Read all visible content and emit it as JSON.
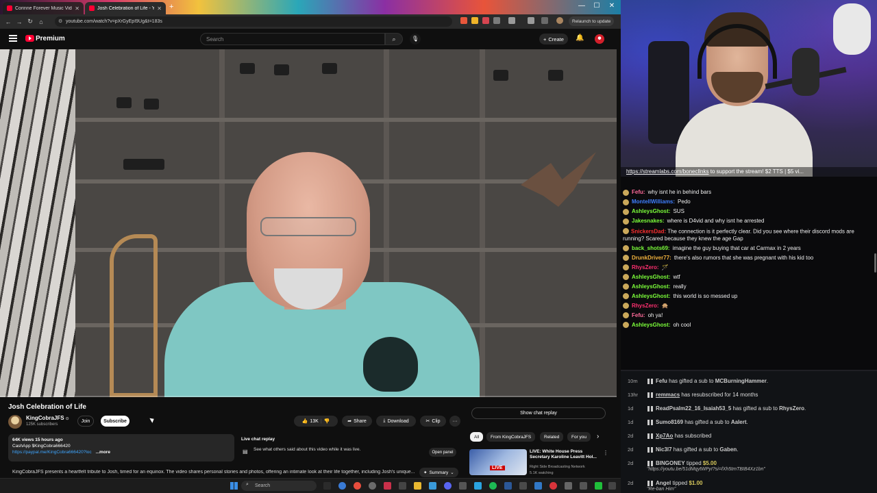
{
  "browser": {
    "tabs": [
      {
        "label": "Corinne Forever Music Video - ",
        "active": false
      },
      {
        "label": "Josh Celebration of Life - Y",
        "active": true
      }
    ],
    "new_tab": "+",
    "url": "youtube.com/watch?v=pXrGyEpI9Ug&t=183s",
    "relaunch": "Relaunch to update",
    "window_controls": [
      "—",
      "☐",
      "✕"
    ],
    "nav": [
      "←",
      "→",
      "↻",
      "⌂"
    ]
  },
  "youtube": {
    "brand": "Premium",
    "search_placeholder": "Search",
    "create": "Create",
    "create_icon": "+"
  },
  "video": {
    "title": "Josh Celebration of Life",
    "progress": 0.0
  },
  "channel": {
    "name": "KingCobraJFS",
    "verified": "⊙",
    "subscribers": "125K subscribers",
    "join": "Join",
    "subscribe": "Subscribe"
  },
  "actions": {
    "likes": "13K",
    "share": "Share",
    "download": "Download",
    "clip": "Clip",
    "more": "···"
  },
  "description": {
    "views_time": "64K views  15 hours ago",
    "cashapp": "CashApp $KingCobra666420",
    "paypal": "https://paypal.me/KingCobra666420?loc",
    "more": "...more",
    "summary_line": "KingCobraJFS presents a heartfelt tribute to Josh, timed for an equinox. The video shares personal stories and photos, offering an intimate look at their life together, including Josh's unique...",
    "summary_label": "Summary"
  },
  "live_chat_replay": {
    "heading": "Live chat replay",
    "text": "See what others said about this video while it was live.",
    "open_panel": "Open panel"
  },
  "sidebar": {
    "show_chat": "Show chat replay",
    "chips": [
      "All",
      "From KingCobraJFS",
      "Related",
      "For you"
    ],
    "chip_next": "›",
    "recommendation": {
      "title": "LIVE: White House Press Secretary Karoline Leavitt Hol...",
      "channel": "Right Side Broadcasting Network",
      "watching": "5.1K watching",
      "badge": "LIVE"
    }
  },
  "taskbar": {
    "search_placeholder": "Search"
  },
  "overlay": {
    "ticker_link": "https://streamlabs.com/bonecllnks",
    "ticker_text": " to support the stream! $2 TTS | $5 vi..."
  },
  "chat": [
    {
      "name": "Fefu",
      "text": "why isnt he in behind bars",
      "color": "#ff6b9a"
    },
    {
      "name": "MontellWilliams",
      "text": "Pedo",
      "color": "#3f7fff"
    },
    {
      "name": "AshleysGhost",
      "text": "SUS",
      "color": "#7cff3a"
    },
    {
      "name": "Jakesnakes",
      "text": "where is D4vid and why isnt he arrested",
      "color": "#7cff3a"
    },
    {
      "name": "SnickersDad",
      "text": "The connection is it perfectly clear. Did you see where their discord mods are running? Scared because they knew the age Gap",
      "color": "#ff3030"
    },
    {
      "name": "back_shots69",
      "text": "imagine the guy buying that car at Carmax in 2 years",
      "color": "#7cff3a"
    },
    {
      "name": "DrunkDriver77",
      "text": "there's also rumors that she was pregnant with his kid too",
      "color": "#f2b33d"
    },
    {
      "name": "RhysZero",
      "text": "🪄",
      "color": "#ff3070"
    },
    {
      "name": "AshleysGhost",
      "text": "wtf",
      "color": "#7cff3a"
    },
    {
      "name": "AshleysGhost",
      "text": "really",
      "color": "#7cff3a"
    },
    {
      "name": "AshleysGhost",
      "text": "this world is so messed up",
      "color": "#7cff3a"
    },
    {
      "name": "RhysZero",
      "text": "🙊",
      "color": "#ff3070"
    },
    {
      "name": "Fefu",
      "text": "oh ya!",
      "color": "#ff6b9a"
    },
    {
      "name": "AshleysGhost",
      "text": "oh cool",
      "color": "#7cff3a"
    }
  ],
  "events": [
    {
      "time": "10m",
      "who": "Fefu",
      "action": " has gifted a sub to ",
      "target": "MCBurningHammer",
      "end": "."
    },
    {
      "time": "13hr",
      "who": "remmacs",
      "action": " has resubscribed for 14 months",
      "target": "",
      "end": ""
    },
    {
      "time": "1d",
      "who": "ReadPsalm22_16_Isaiah53_5",
      "action": " has gifted a sub to ",
      "target": "RhysZero",
      "end": "."
    },
    {
      "time": "1d",
      "who": "Sumo8169",
      "action": " has gifted a sub to ",
      "target": "Aalert",
      "end": "."
    },
    {
      "time": "2d",
      "who": "Xp7Ao",
      "action": " has subscribed",
      "target": "",
      "end": ""
    },
    {
      "time": "2d",
      "who": "Nic3l7",
      "action": " has gifted a sub to ",
      "target": "Gaben",
      "end": "."
    },
    {
      "time": "2d",
      "who": "BINGONEY",
      "action": " tipped ",
      "amount": "$5.00",
      "note": "\"https://youtu.be/51dMqytWPyI?si=fXh5tmTBIB4Xz1bn\""
    },
    {
      "time": "2d",
      "who": "Angel",
      "action": " tipped ",
      "amount": "$1.00",
      "note": "\"Re-ban Him\""
    }
  ]
}
